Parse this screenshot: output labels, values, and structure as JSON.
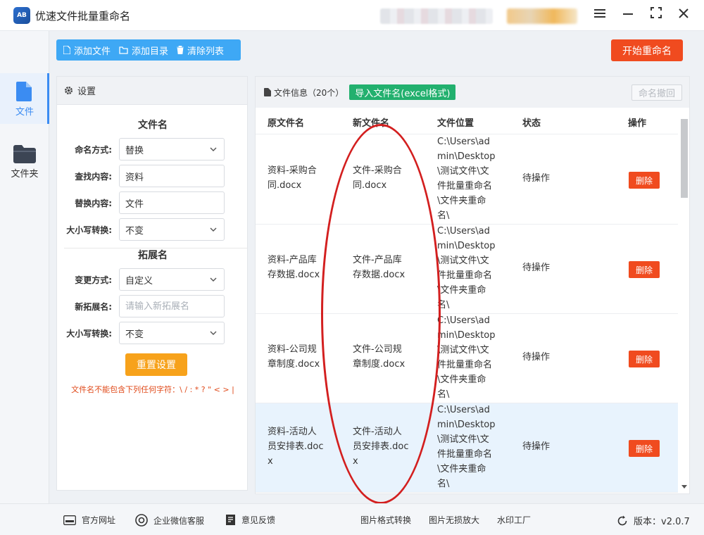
{
  "app": {
    "logo_text": "AB",
    "title": "优速文件批量重命名"
  },
  "nav": [
    {
      "label": "文件",
      "icon": "file-icon",
      "active": true
    },
    {
      "label": "文件夹",
      "icon": "folder-icon",
      "active": false
    }
  ],
  "toolbar": {
    "add_file": "添加文件",
    "add_dir": "添加目录",
    "clear_list": "清除列表",
    "start": "开始重命名"
  },
  "settings": {
    "header": "设置",
    "filename_section": "文件名",
    "naming_mode_label": "命名方式:",
    "naming_mode_value": "替换",
    "find_label": "查找内容:",
    "find_value": "资料",
    "replace_label": "替换内容:",
    "replace_value": "文件",
    "case_label": "大小写转换:",
    "case_value": "不变",
    "ext_section": "拓展名",
    "ext_mode_label": "变更方式:",
    "ext_mode_value": "自定义",
    "new_ext_label": "新拓展名:",
    "new_ext_placeholder": "请输入新拓展名",
    "ext_case_label": "大小写转换:",
    "ext_case_value": "不变",
    "reset": "重置设置",
    "warning": "文件名不能包含下列任何字符：\\ / : * ? \" < > |"
  },
  "files": {
    "info_label": "文件信息",
    "count": "（20个）",
    "import_btn": "导入文件名(excel格式)",
    "undo_btn": "命名撤回",
    "columns": [
      "原文件名",
      "新文件名",
      "文件位置",
      "状态",
      "操作"
    ],
    "rows": [
      {
        "orig": [
          "资料-采购合",
          "同.docx"
        ],
        "new": [
          "文件-采购合",
          "同.docx"
        ],
        "path": [
          "C:\\Users\\ad",
          "min\\Desktop",
          "\\测试文件\\文",
          "件批量重命名",
          "\\文件夹重命",
          "名\\"
        ],
        "status": "待操作",
        "action": "删除"
      },
      {
        "orig": [
          "资料-产品库",
          "存数据.docx"
        ],
        "new": [
          "文件-产品库",
          "存数据.docx"
        ],
        "path": [
          "C:\\Users\\ad",
          "min\\Desktop",
          "\\测试文件\\文",
          "件批量重命名",
          "\\文件夹重命",
          "名\\"
        ],
        "status": "待操作",
        "action": "删除"
      },
      {
        "orig": [
          "资料-公司规",
          "章制度.docx"
        ],
        "new": [
          "文件-公司规",
          "章制度.docx"
        ],
        "path": [
          "C:\\Users\\ad",
          "min\\Desktop",
          "\\测试文件\\文",
          "件批量重命名",
          "\\文件夹重命",
          "名\\"
        ],
        "status": "待操作",
        "action": "删除"
      },
      {
        "orig": [
          "资料-活动人",
          "员安排表.doc",
          "x"
        ],
        "new": [
          "文件-活动人",
          "员安排表.doc",
          "x"
        ],
        "path": [
          "C:\\Users\\ad",
          "min\\Desktop",
          "\\测试文件\\文",
          "件批量重命名",
          "\\文件夹重命",
          "名\\"
        ],
        "status": "待操作",
        "action": "删除"
      }
    ]
  },
  "footer": {
    "website": "官方网址",
    "wechat": "企业微信客服",
    "feedback": "意见反馈",
    "img_convert": "图片格式转换",
    "img_enlarge": "图片无损放大",
    "watermark": "水印工厂",
    "version_label": "版本：",
    "version": "v2.0.7"
  },
  "colors": {
    "accent": "#3ea8f5",
    "danger": "#f04b1f",
    "warning": "#f7a21b",
    "success": "#22b06e",
    "annotation": "#d31f1f"
  }
}
